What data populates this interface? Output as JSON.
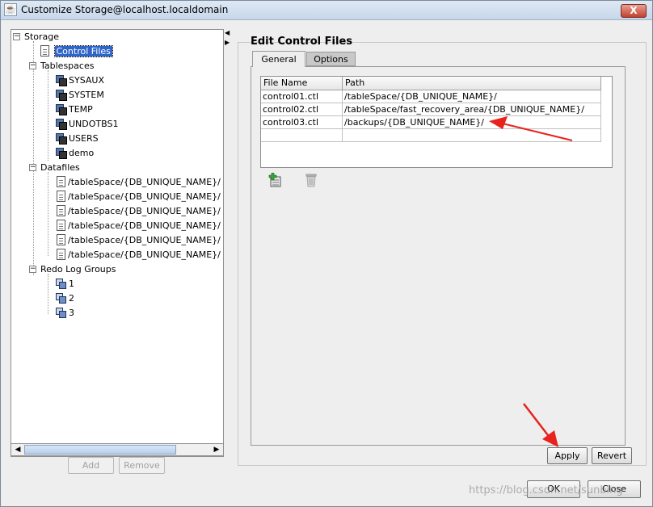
{
  "window": {
    "title": "Customize Storage@localhost.localdomain",
    "close_glyph": "X",
    "app_icon": "java-icon"
  },
  "tree": {
    "root": "Storage",
    "control_files": "Control Files",
    "tablespaces": {
      "label": "Tablespaces",
      "items": [
        "SYSAUX",
        "SYSTEM",
        "TEMP",
        "UNDOTBS1",
        "USERS",
        "demo"
      ]
    },
    "datafiles": {
      "label": "Datafiles",
      "items": [
        "/tableSpace/{DB_UNIQUE_NAME}/",
        "/tableSpace/{DB_UNIQUE_NAME}/",
        "/tableSpace/{DB_UNIQUE_NAME}/",
        "/tableSpace/{DB_UNIQUE_NAME}/",
        "/tableSpace/{DB_UNIQUE_NAME}/",
        "/tableSpace/{DB_UNIQUE_NAME}/"
      ]
    },
    "redo_log_groups": {
      "label": "Redo Log Groups",
      "items": [
        "1",
        "2",
        "3"
      ]
    }
  },
  "left_buttons": {
    "add": "Add",
    "remove": "Remove"
  },
  "panel": {
    "title": "Edit Control Files",
    "tabs": [
      "General",
      "Options"
    ],
    "table": {
      "columns": [
        "File Name",
        "Path"
      ],
      "rows": [
        [
          "control01.ctl",
          "/tableSpace/{DB_UNIQUE_NAME}/"
        ],
        [
          "control02.ctl",
          "/tableSpace/fast_recovery_area/{DB_UNIQUE_NAME}/"
        ],
        [
          "control03.ctl",
          "/backups/{DB_UNIQUE_NAME}/"
        ],
        [
          "",
          ""
        ]
      ]
    }
  },
  "buttons": {
    "apply": "Apply",
    "revert": "Revert",
    "ok": "OK",
    "close": "Close"
  },
  "watermark": "https://blog.csdn.net/sunbing",
  "annotation_color": "#e8231d"
}
